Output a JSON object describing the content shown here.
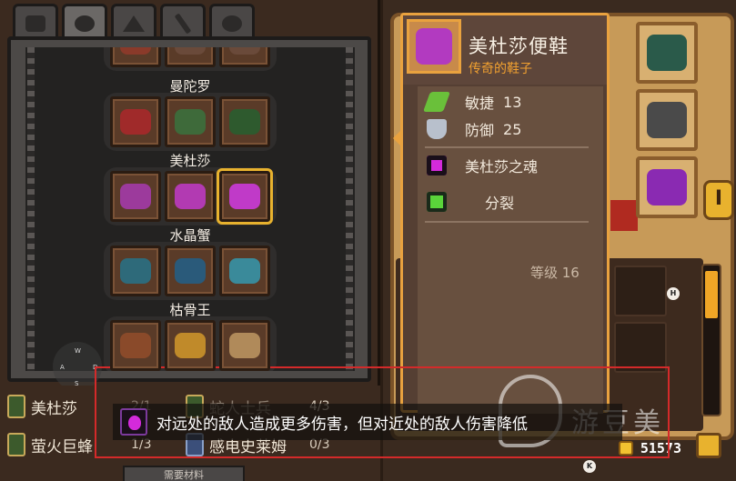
{
  "tabs": [
    {
      "icon": "hat-icon"
    },
    {
      "icon": "helmet-icon"
    },
    {
      "icon": "cloak-icon"
    },
    {
      "icon": "sword-icon"
    },
    {
      "icon": "ring-icon"
    }
  ],
  "groups": [
    {
      "label": "曼陀罗"
    },
    {
      "label": "美杜莎"
    },
    {
      "label": "水晶蟹"
    },
    {
      "label": "枯骨王"
    }
  ],
  "materials": [
    {
      "name": "美杜莎",
      "count": "2/1"
    },
    {
      "name": "蛇人士兵",
      "count": "4/3"
    },
    {
      "name": "萤火巨蜂",
      "count": "1/3"
    },
    {
      "name": "感电史莱姆",
      "count": "0/3"
    }
  ],
  "need_button": "需要材料",
  "tooltip": {
    "title": "美杜莎便鞋",
    "subtitle": "传奇的鞋子",
    "stats": [
      {
        "icon": "feather-icon",
        "label": "敏捷",
        "value": "13"
      },
      {
        "icon": "shield-icon",
        "label": "防御",
        "value": "25"
      }
    ],
    "perks": [
      {
        "icon": "purple-flame-icon",
        "label": "美杜莎之魂"
      },
      {
        "icon": "split-arrows-icon",
        "label": "分裂"
      }
    ],
    "level": "等级 16"
  },
  "description": "对远处的敌人造成更多伤害，但对近处的敌人伤害降低",
  "gold": "51573",
  "side_tab_label": "I",
  "watermark": "游豆美",
  "key_hints": [
    "H",
    "U",
    "K",
    "W",
    "A",
    "S",
    "D"
  ],
  "colors": {
    "accent": "#e9a23f",
    "legendary": "#f0a030",
    "purple": "#d42adb",
    "highlight_frame": "#d42a2a"
  }
}
